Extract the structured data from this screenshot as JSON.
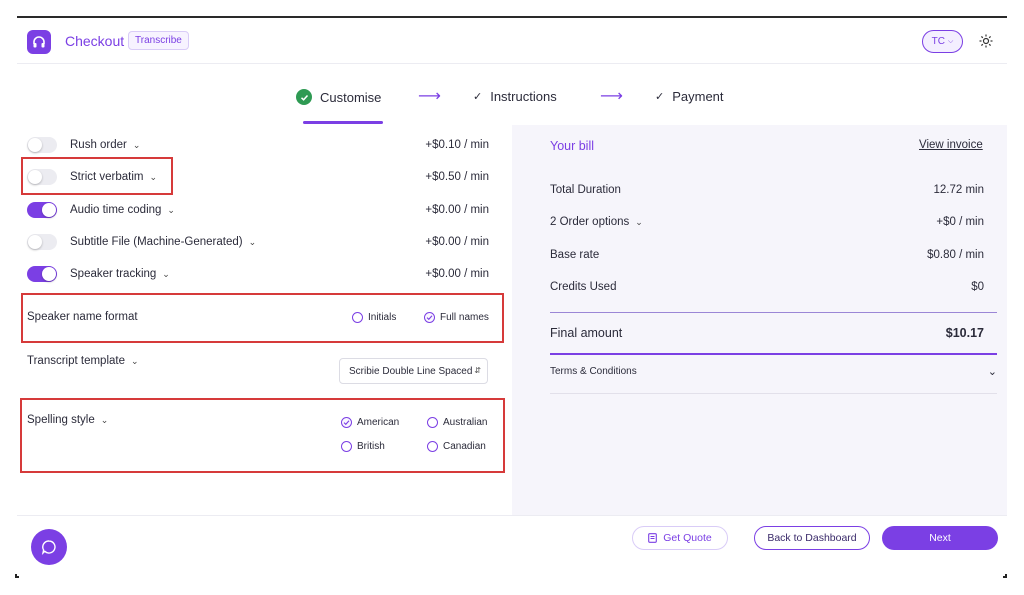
{
  "header": {
    "app_title": "Checkout",
    "app_tag": "Transcribe",
    "user_initials": "TC",
    "brand_color": "#7b3fe4",
    "logo_icon": "headphones-icon",
    "theme_icon": "sun-icon"
  },
  "steps": [
    {
      "label": "Customise",
      "status": "current-done"
    },
    {
      "label": "Instructions",
      "status": "done"
    },
    {
      "label": "Payment",
      "status": "done"
    }
  ],
  "options": [
    {
      "label": "Rush order",
      "price": "+$0.10 / min",
      "enabled": false
    },
    {
      "label": "Strict verbatim",
      "price": "+$0.50 / min",
      "enabled": false
    },
    {
      "label": "Audio time coding",
      "price": "+$0.00 / min",
      "enabled": true
    },
    {
      "label": "Subtitle File (Machine-Generated)",
      "price": "+$0.00 / min",
      "enabled": false
    },
    {
      "label": "Speaker tracking",
      "price": "+$0.00 / min",
      "enabled": true
    }
  ],
  "speaker_name_format": {
    "label": "Speaker name format",
    "choices": [
      "Initials",
      "Full names"
    ],
    "selected": "Full names"
  },
  "transcript_template": {
    "label": "Transcript template",
    "value": "Scribie Double Line Spaced"
  },
  "spelling_style": {
    "label": "Spelling style",
    "choices": [
      "American",
      "Australian",
      "British",
      "Canadian"
    ],
    "selected": "American"
  },
  "bill": {
    "title": "Your bill",
    "view_invoice": "View invoice",
    "rows": [
      {
        "label": "Total Duration",
        "value": "12.72 min"
      },
      {
        "label": "2 Order options",
        "value": "+$0 / min"
      },
      {
        "label": "Base rate",
        "value": "$0.80 / min"
      },
      {
        "label": "Credits Used",
        "value": "$0"
      }
    ],
    "final_label": "Final amount",
    "final_value": "$10.17",
    "terms": "Terms & Conditions"
  },
  "footer": {
    "get_quote": "Get Quote",
    "back": "Back to Dashboard",
    "next": "Next"
  },
  "highlight_color": "#d63a3a"
}
